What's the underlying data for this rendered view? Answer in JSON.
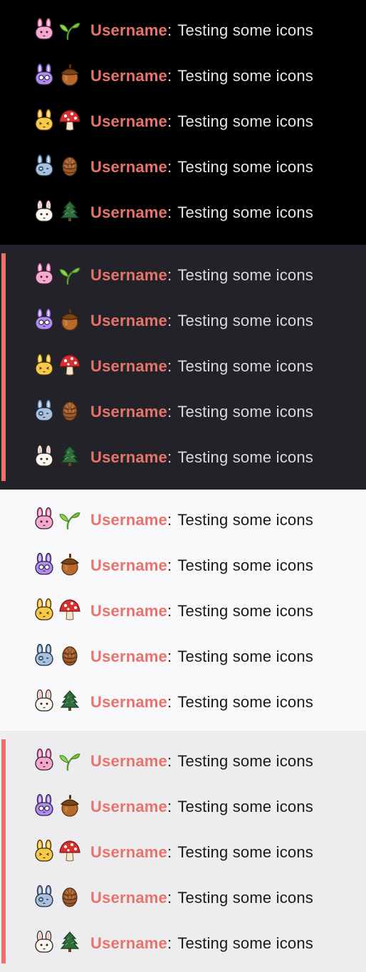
{
  "theme": {
    "accent": "#e8736c",
    "username_color": "#e8736c"
  },
  "sections": [
    {
      "name": "dark-black",
      "bg": "#000000",
      "text_color": "#e6e6e6",
      "mentioned": false
    },
    {
      "name": "dark-highlight",
      "bg": "#232228",
      "text_color": "#d9d9de",
      "mentioned": true
    },
    {
      "name": "light",
      "bg": "#f8f8fa",
      "text_color": "#1a1a1a",
      "mentioned": false
    },
    {
      "name": "light-highlight",
      "bg": "#ededef",
      "text_color": "#1a1a1a",
      "mentioned": true
    }
  ],
  "messages": [
    {
      "username": "Username",
      "separator": ":",
      "text": "Testing some icons",
      "badge_icon": "pink-bunny-icon",
      "item_icon": "sprout-icon"
    },
    {
      "username": "Username",
      "separator": ":",
      "text": "Testing some icons",
      "badge_icon": "purple-bunny-glasses-icon",
      "item_icon": "acorn-icon"
    },
    {
      "username": "Username",
      "separator": ":",
      "text": "Testing some icons",
      "badge_icon": "yellow-bunny-icon",
      "item_icon": "mushroom-icon"
    },
    {
      "username": "Username",
      "separator": ":",
      "text": "Testing some icons",
      "badge_icon": "blue-bunny-icon",
      "item_icon": "pinecone-icon"
    },
    {
      "username": "Username",
      "separator": ":",
      "text": "Testing some icons",
      "badge_icon": "white-bunny-icon",
      "item_icon": "pine-tree-icon"
    }
  ]
}
